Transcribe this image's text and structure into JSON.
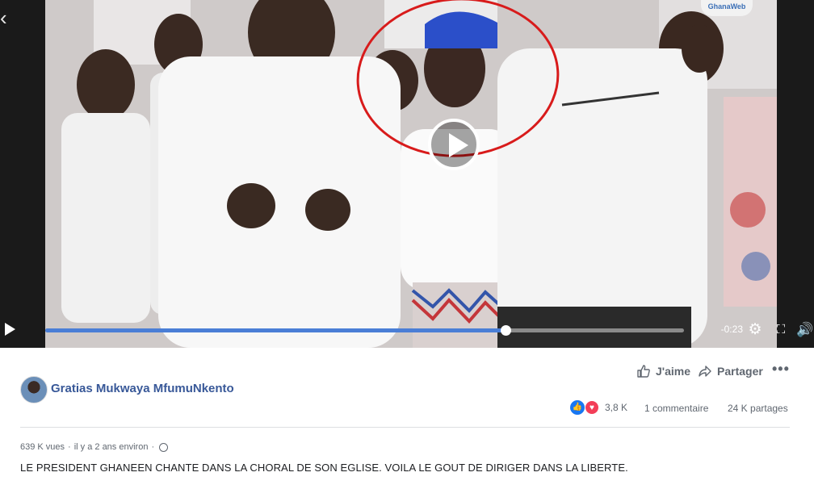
{
  "video": {
    "watermark": "GhanaWeb",
    "icons": {
      "back": "chevron-left-icon",
      "play": "play-icon",
      "settings": "gear-icon",
      "fullscreen": "fullscreen-icon",
      "volume": "volume-icon"
    },
    "progress": 0.72,
    "time_remaining": "-0:23",
    "accent_color": "#4a7ed6",
    "annotation_color": "#d81b1b"
  },
  "post": {
    "author": "Gratias Mukwaya MfumuNkento",
    "like_label": "J'aime",
    "share_label": "Partager",
    "more_label": "•••",
    "reaction_count": "3,8 K",
    "comments": "1 commentaire",
    "shares": "24 K partages",
    "views": "639 K vues",
    "time": "il y a 2 ans environ",
    "separator": "·",
    "caption": "LE PRESIDENT GHANEEN CHANTE DANS LA CHORAL DE SON EGLISE. VOILA LE GOUT DE DIRIGER DANS LA LIBERTE."
  }
}
